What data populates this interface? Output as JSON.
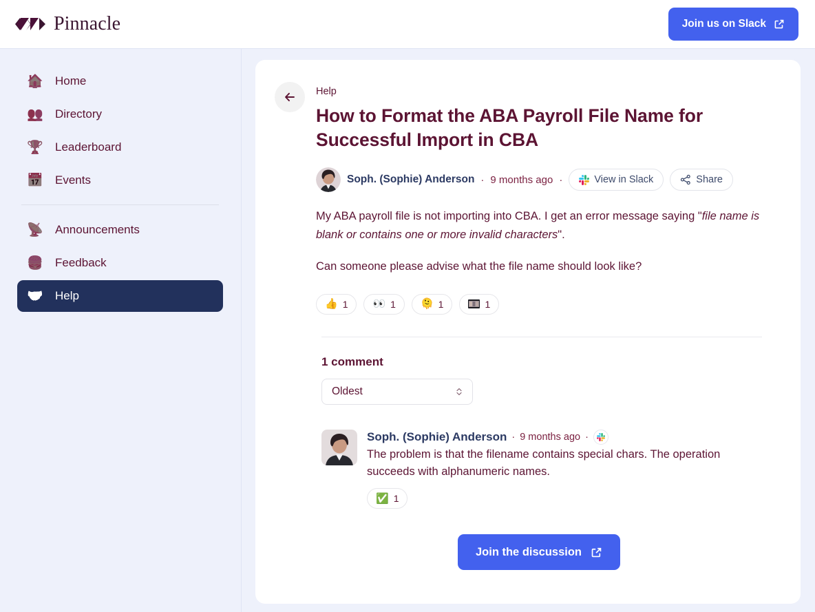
{
  "topbar": {
    "brand_name": "Pinnacle",
    "cta_label": "Join us on Slack"
  },
  "sidebar": {
    "items": [
      {
        "label": "Home",
        "icon": "house-icon",
        "emoji": "🏠",
        "active": false
      },
      {
        "label": "Directory",
        "icon": "people-icon",
        "emoji": "👥",
        "active": false
      },
      {
        "label": "Leaderboard",
        "icon": "trophy-icon",
        "emoji": "🏆",
        "active": false
      },
      {
        "label": "Events",
        "icon": "calendar-icon",
        "emoji": "📅",
        "active": false
      },
      {
        "label": "Announcements",
        "icon": "satellite-icon",
        "emoji": "📡",
        "active": false
      },
      {
        "label": "Feedback",
        "icon": "hamburger-icon",
        "emoji": "🍔",
        "active": false
      },
      {
        "label": "Help",
        "icon": "handshake-icon",
        "emoji": "🤝",
        "active": true
      }
    ]
  },
  "post": {
    "breadcrumb": "Help",
    "title": "How to Format the ABA Payroll File Name for Successful Import in CBA",
    "author": "Soph. (Sophie) Anderson",
    "timestamp": "9 months ago",
    "separator": "·",
    "view_in_slack_label": "View in Slack",
    "share_label": "Share",
    "paragraph_1_a": "My ABA payroll file is not importing into CBA. I get an error message saying \"",
    "paragraph_1_em": "file name is blank or contains one or more invalid characters",
    "paragraph_1_b": "\".",
    "paragraph_2": "Can someone please advise what the file name should look like?",
    "reactions": [
      {
        "name": "thumbs-up-reaction",
        "emoji": "👍",
        "count": "1",
        "type": "emoji"
      },
      {
        "name": "eyes-reaction",
        "emoji": "👀",
        "count": "1",
        "type": "emoji"
      },
      {
        "name": "face-reaction",
        "emoji": "🫠",
        "count": "1",
        "type": "emoji"
      },
      {
        "name": "custom-image-reaction",
        "emoji": "",
        "count": "1",
        "type": "image"
      }
    ]
  },
  "comments": {
    "heading": "1 comment",
    "sort_value": "Oldest",
    "list": [
      {
        "author": "Soph. (Sophie) Anderson",
        "timestamp": "9 months ago",
        "separator": "·",
        "body": "The problem is that the filename contains special chars. The operation succeeds with alphanumeric names.",
        "reaction_emoji": "✅",
        "reaction_count": "1"
      }
    ],
    "cta_label": "Join the discussion"
  },
  "colors": {
    "accent_blue": "#4361ee",
    "brand_maroon": "#5c1433",
    "active_navy": "#22315c",
    "sidebar_bg": "#eef1fb"
  }
}
